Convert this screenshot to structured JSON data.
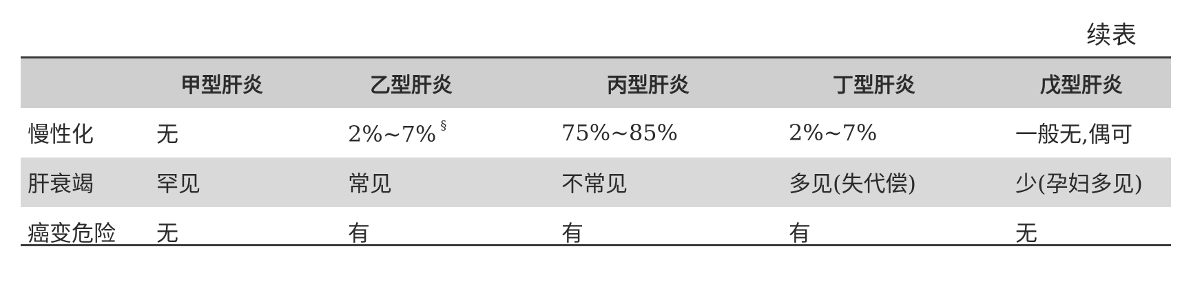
{
  "continued_label": "续表",
  "columns": [
    "",
    "甲型肝炎",
    "乙型肝炎",
    "丙型肝炎",
    "丁型肝炎",
    "戊型肝炎"
  ],
  "rows": [
    {
      "label": "慢性化",
      "cells": [
        "无",
        "2%~7%",
        "75%~85%",
        "2%~7%",
        "一般无,偶可"
      ],
      "footnote_mark": "§"
    },
    {
      "label": "肝衰竭",
      "cells": [
        "罕见",
        "常见",
        "不常见",
        "多见(失代偿)",
        "少(孕妇多见)"
      ]
    },
    {
      "label": "癌变危险",
      "cells": [
        "无",
        "有",
        "有",
        "有",
        "无"
      ]
    }
  ]
}
